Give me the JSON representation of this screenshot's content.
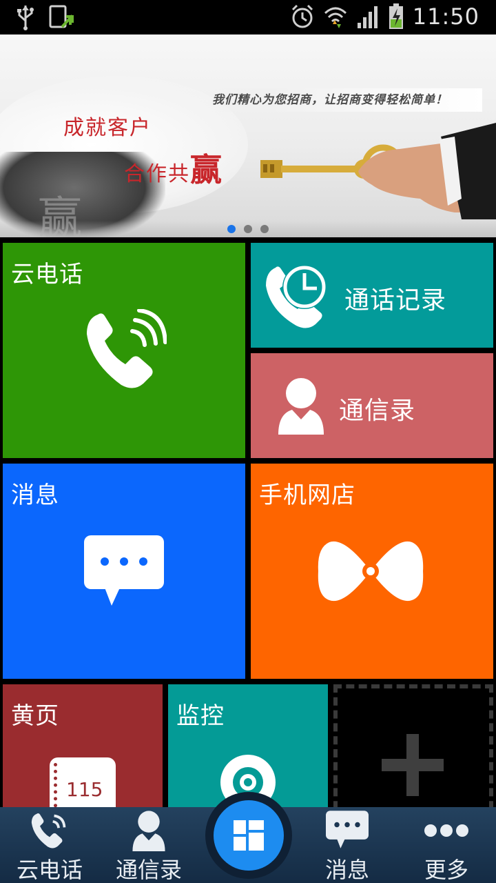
{
  "status_bar": {
    "time": "11:50",
    "icons": [
      "usb-icon",
      "screenshot-icon",
      "alarm-icon",
      "wifi-icon",
      "signal-icon",
      "battery-charging-icon"
    ]
  },
  "banner": {
    "slogan": "我们精心为您招商，让招商变得轻松简单！",
    "title_line1": "成就客户",
    "title_line2_prefix": "合作共",
    "title_line2_big": "赢",
    "rock_char": "赢",
    "carousel": {
      "count": 3,
      "active_index": 0
    }
  },
  "tiles": {
    "cloud_phone": {
      "label": "云电话",
      "color": "#2e9606",
      "icon": "phone-waves-icon"
    },
    "call_log": {
      "label": "通话记录",
      "color": "#039b9a",
      "icon": "phone-clock-icon"
    },
    "contacts": {
      "label": "通信录",
      "color": "#cd6265",
      "icon": "person-icon"
    },
    "messages": {
      "label": "消息",
      "color": "#0b67fd",
      "icon": "chat-bubble-icon"
    },
    "mobile_shop": {
      "label": "手机网店",
      "color": "#fe6500",
      "icon": "bow-tie-icon"
    },
    "yellow_pages": {
      "label": "黄页",
      "color": "#9a2c2f",
      "icon": "notebook-115-icon",
      "badge": "115"
    },
    "monitor": {
      "label": "监控",
      "color": "#049b96",
      "icon": "webcam-icon"
    },
    "add_tile": {
      "icon": "plus-icon"
    }
  },
  "bottom_nav": {
    "items": [
      {
        "label": "云电话",
        "icon": "phone-waves-icon"
      },
      {
        "label": "通信录",
        "icon": "person-icon"
      },
      {
        "label": "",
        "icon": "grid-icon"
      },
      {
        "label": "消息",
        "icon": "chat-bubble-icon"
      },
      {
        "label": "更多",
        "icon": "more-dots-icon"
      }
    ]
  }
}
